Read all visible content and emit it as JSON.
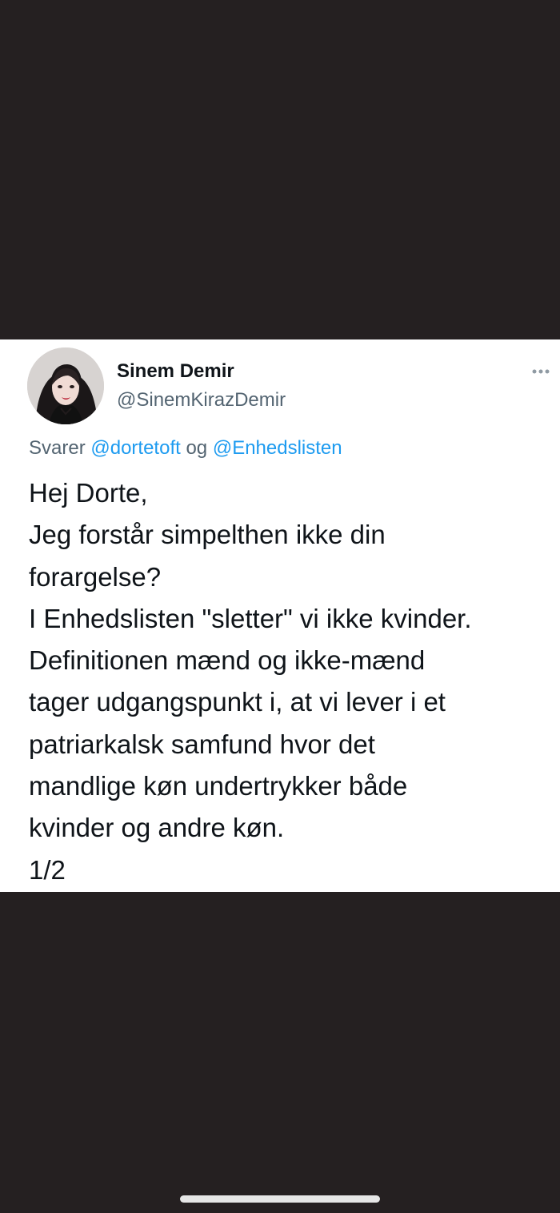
{
  "tweet": {
    "author": {
      "display_name": "Sinem Demir",
      "handle": "@SinemKirazDemir",
      "avatar_icon": "profile-photo"
    },
    "more_options_icon": "more-options-icon",
    "reply_to": {
      "prefix": "Svarer",
      "mentions": [
        "@dortetoft",
        "@Enhedslisten"
      ],
      "joiner": "og"
    },
    "body_lines": [
      "Hej Dorte,",
      "Jeg forstår simpelthen ikke din",
      "forargelse?",
      "I Enhedslisten \"sletter\" vi ikke kvinder.",
      "Definitionen mænd og ikke-mænd",
      "tager udgangspunkt i, at vi lever i et",
      "patriarkalsk samfund hvor det",
      "mandlige køn undertrykker både",
      "kvinder og andre køn.",
      "1/2"
    ]
  },
  "colors": {
    "background_dark": "#252021",
    "card": "#ffffff",
    "text_primary": "#0f1419",
    "text_secondary": "#536471",
    "link_blue": "#1d9bf0"
  }
}
